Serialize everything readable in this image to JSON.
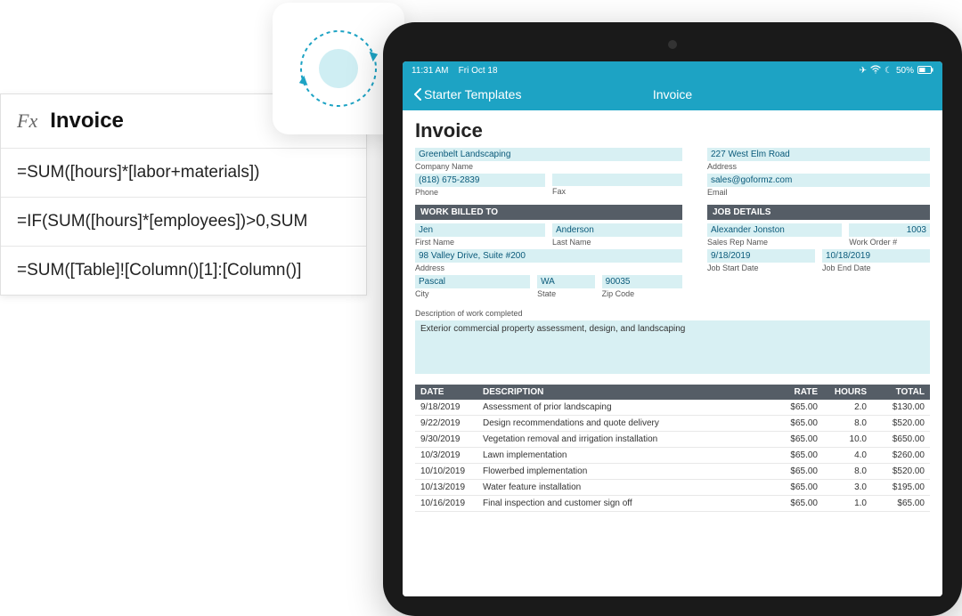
{
  "formula_panel": {
    "fx": "Fx",
    "title": "Invoice",
    "rows": [
      "=SUM([hours]*[labor+materials])",
      "=IF(SUM([hours]*[employees])>0,SUM",
      "=SUM([Table]![Column()[1]:[Column()]"
    ]
  },
  "status": {
    "time": "11:31 AM",
    "date": "Fri Oct 18",
    "battery": "50%"
  },
  "nav": {
    "back": "Starter Templates",
    "title": "Invoice"
  },
  "form": {
    "title": "Invoice",
    "company": {
      "name_value": "Greenbelt Landscaping",
      "name_label": "Company Name",
      "address_value": "227 West Elm Road",
      "address_label": "Address",
      "phone_value": "(818) 675-2839",
      "phone_label": "Phone",
      "fax_label": "Fax",
      "email_value": "sales@goformz.com",
      "email_label": "Email"
    },
    "billed_header": "WORK BILLED TO",
    "job_header": "JOB DETAILS",
    "billed": {
      "first_name_value": "Jen",
      "first_name_label": "First Name",
      "last_name_value": "Anderson",
      "last_name_label": "Last Name",
      "address_value": "98 Valley Drive, Suite #200",
      "address_label": "Address",
      "city_value": "Pascal",
      "city_label": "City",
      "state_value": "WA",
      "state_label": "State",
      "zip_value": "90035",
      "zip_label": "Zip Code"
    },
    "job": {
      "rep_value": "Alexander Jonston",
      "rep_label": "Sales Rep Name",
      "wo_value": "1003",
      "wo_label": "Work Order #",
      "start_value": "9/18/2019",
      "start_label": "Job Start Date",
      "end_value": "10/18/2019",
      "end_label": "Job End Date"
    },
    "desc_label": "Description of work completed",
    "desc_value": "Exterior commercial property assessment, design, and landscaping",
    "items_header": {
      "date": "DATE",
      "desc": "DESCRIPTION",
      "rate": "RATE",
      "hours": "HOURS",
      "total": "TOTAL"
    },
    "items": [
      {
        "date": "9/18/2019",
        "desc": "Assessment of prior landscaping",
        "rate": "$65.00",
        "hours": "2.0",
        "total": "$130.00"
      },
      {
        "date": "9/22/2019",
        "desc": "Design recommendations and quote delivery",
        "rate": "$65.00",
        "hours": "8.0",
        "total": "$520.00"
      },
      {
        "date": "9/30/2019",
        "desc": "Vegetation removal and irrigation installation",
        "rate": "$65.00",
        "hours": "10.0",
        "total": "$650.00"
      },
      {
        "date": "10/3/2019",
        "desc": "Lawn implementation",
        "rate": "$65.00",
        "hours": "4.0",
        "total": "$260.00"
      },
      {
        "date": "10/10/2019",
        "desc": "Flowerbed implementation",
        "rate": "$65.00",
        "hours": "8.0",
        "total": "$520.00"
      },
      {
        "date": "10/13/2019",
        "desc": "Water feature installation",
        "rate": "$65.00",
        "hours": "3.0",
        "total": "$195.00"
      },
      {
        "date": "10/16/2019",
        "desc": "Final inspection and customer sign off",
        "rate": "$65.00",
        "hours": "1.0",
        "total": "$65.00"
      }
    ]
  }
}
